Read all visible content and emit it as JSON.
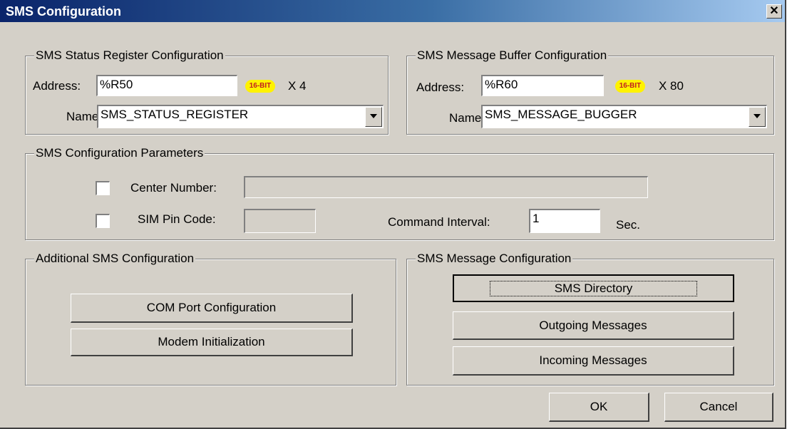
{
  "window": {
    "title": "SMS Configuration",
    "close_glyph": "✕"
  },
  "status_register": {
    "legend": "SMS Status Register Configuration",
    "address_label": "Address:",
    "address_value": "%R50",
    "badge": "16-BIT",
    "multiplier": "X 4",
    "name_label": "Name:",
    "name_value": "SMS_STATUS_REGISTER"
  },
  "message_buffer": {
    "legend": "SMS Message Buffer Configuration",
    "address_label": "Address:",
    "address_value": "%R60",
    "badge": "16-BIT",
    "multiplier": "X 80",
    "name_label": "Name:",
    "name_value": "SMS_MESSAGE_BUGGER"
  },
  "parameters": {
    "legend": "SMS Configuration Parameters",
    "center_number_label": "Center Number:",
    "center_number_value": "",
    "sim_pin_label": "SIM Pin Code:",
    "sim_pin_value": "",
    "command_interval_label": "Command Interval:",
    "command_interval_value": "1",
    "sec_label": "Sec."
  },
  "additional": {
    "legend": "Additional SMS Configuration",
    "com_port_button": "COM Port Configuration",
    "modem_init_button": "Modem Initialization"
  },
  "message_config": {
    "legend": "SMS Message Configuration",
    "directory_button": "SMS Directory",
    "outgoing_button": "Outgoing Messages",
    "incoming_button": "Incoming Messages"
  },
  "footer": {
    "ok_button": "OK",
    "cancel_button": "Cancel"
  }
}
